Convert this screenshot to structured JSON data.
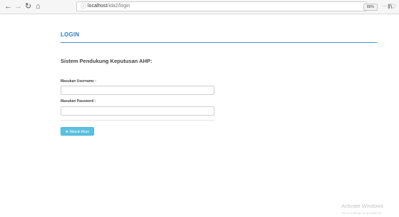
{
  "browser": {
    "url_host": "localhost",
    "url_path": "/ida2/login",
    "zoom": "80%",
    "more_label": "···"
  },
  "page": {
    "title": "LOGIN",
    "subtitle": "Sistem Pendukung Keputusan AHP:",
    "username_label": "Masukan Username :",
    "username_value": "",
    "password_label": "Masukan Password :",
    "password_value": "",
    "submit_label": "Masuk Akun"
  },
  "watermark": {
    "title": "Activate Windows",
    "subtitle": "Go to Settings to activate Wi"
  },
  "icons": {
    "back": "back-arrow-icon",
    "forward": "forward-arrow-icon",
    "reload": "reload-icon",
    "home": "home-icon",
    "site_info": "info-icon",
    "pocket": "pocket-icon",
    "bookmark": "star-icon",
    "library": "library-icon",
    "user": "user-icon"
  },
  "colors": {
    "accent": "#2e7ec4",
    "rule": "#4a90d2",
    "button": "#5bc0de"
  }
}
